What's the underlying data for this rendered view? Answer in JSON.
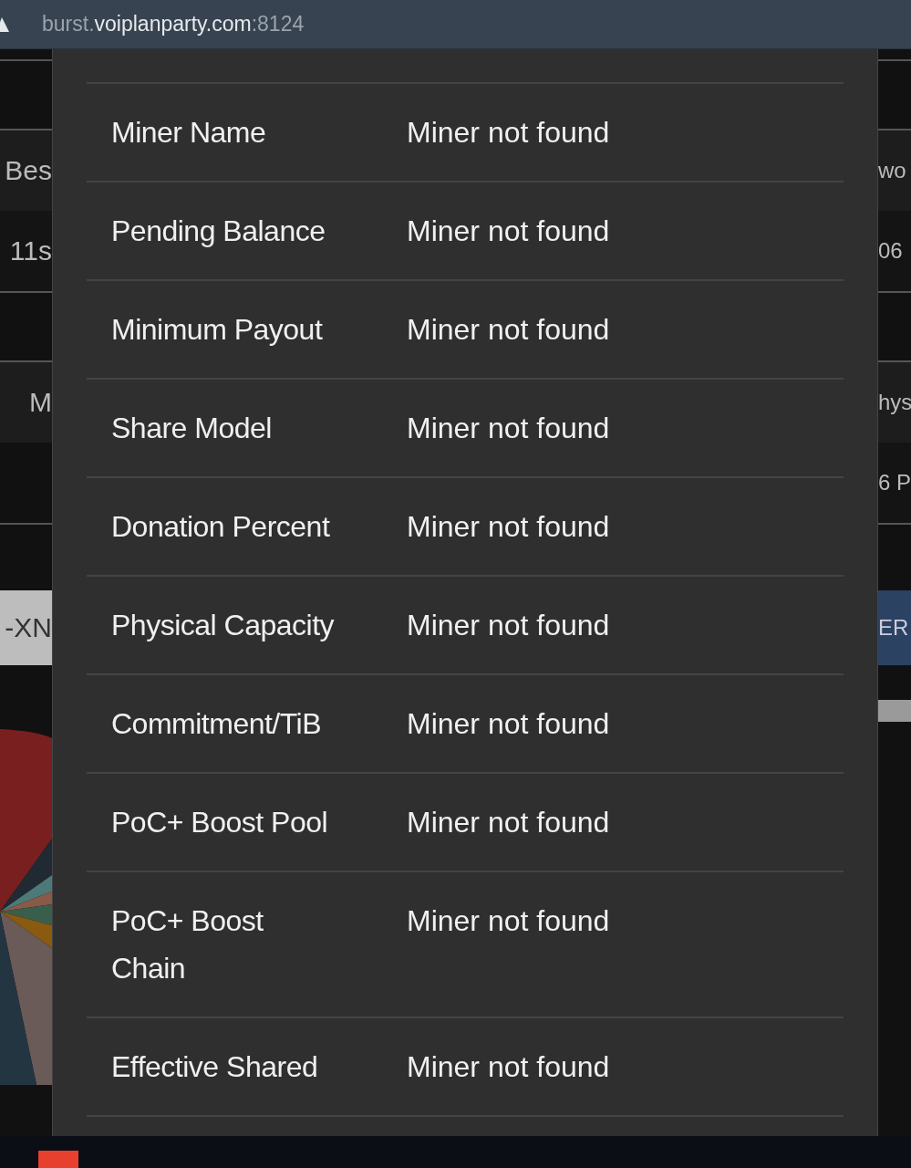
{
  "address_bar": {
    "host_prefix": "burst.",
    "host": "voiplanparty.com",
    "port": ":8124"
  },
  "background_left": [
    {
      "kind": "header",
      "text": "Bes"
    },
    {
      "kind": "cell",
      "text": "11s"
    },
    {
      "kind": "header",
      "text": "M"
    },
    {
      "kind": "tag",
      "text": "-XN"
    }
  ],
  "background_right": [
    {
      "kind": "header",
      "text": "wo"
    },
    {
      "kind": "cell",
      "text": "06"
    },
    {
      "kind": "header",
      "text": "hys"
    },
    {
      "kind": "cell",
      "text": "6 P"
    },
    {
      "kind": "tag",
      "text": "ER"
    }
  ],
  "miner_details": [
    {
      "label": "Miner Name",
      "value": "Miner not found"
    },
    {
      "label": "Pending Balance",
      "value": "Miner not found"
    },
    {
      "label": "Minimum Payout",
      "value": "Miner not found"
    },
    {
      "label": "Share Model",
      "value": "Miner not found"
    },
    {
      "label": "Donation Percent",
      "value": "Miner not found"
    },
    {
      "label": "Physical Capacity",
      "value": "Miner not found"
    },
    {
      "label": "Commitment/TiB",
      "value": "Miner not found"
    },
    {
      "label": "PoC+ Boost Pool",
      "value": "Miner not found"
    },
    {
      "label": "PoC+ Boost\nChain",
      "value": "Miner not found"
    },
    {
      "label": "Effective Shared",
      "value": "Miner not found"
    }
  ]
}
